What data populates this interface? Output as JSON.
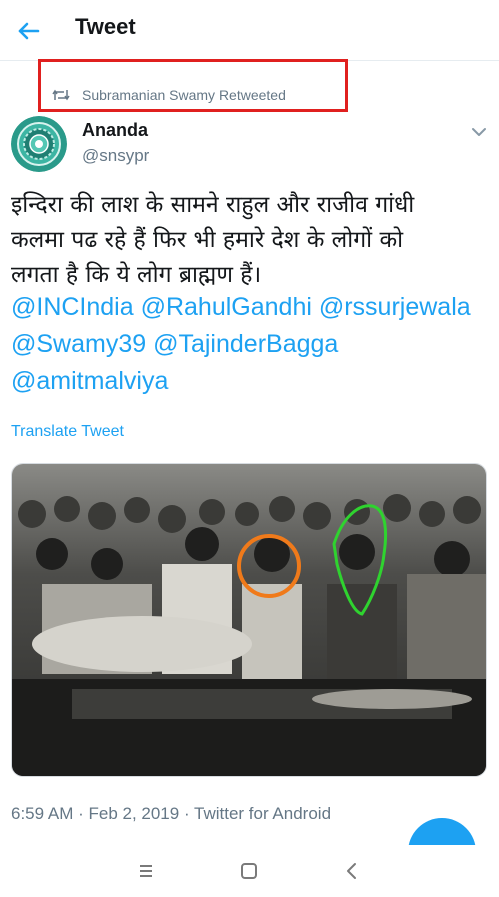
{
  "header": {
    "title": "Tweet",
    "back_icon": "arrow-left-icon"
  },
  "retweet": {
    "text": "Subramanian Swamy Retweeted",
    "icon": "retweet-icon"
  },
  "author": {
    "name": "Ananda",
    "handle": "@snsypr"
  },
  "tweet": {
    "hindi_line_1": "इन्दिरा की लाश के सामने राहुल और राजीव गांधी",
    "hindi_line_2": "कलमा पढ रहे हैं फिर भी हमारे देश के लोगों को",
    "hindi_line_3": "लगता है कि ये लोग ब्राह्मण हैं।",
    "mentions_line_1": "@INCIndia @RahulGandhi @rssurjewala",
    "mentions_line_2": "@Swamy39 @TajinderBagga",
    "mentions_line_3": "@amitmalviya"
  },
  "translate_label": "Translate Tweet",
  "meta": "6:59 AM · Feb 2, 2019 · Twitter for Android",
  "colors": {
    "accent": "#1da1f2",
    "highlight_box": "#e0201f",
    "orange_circle": "#f07a1a",
    "green_outline": "#2fd32f"
  },
  "navbar": {
    "recents_icon": "menu-lines-icon",
    "home_icon": "square-home-icon",
    "back_icon": "chevron-left-icon"
  }
}
